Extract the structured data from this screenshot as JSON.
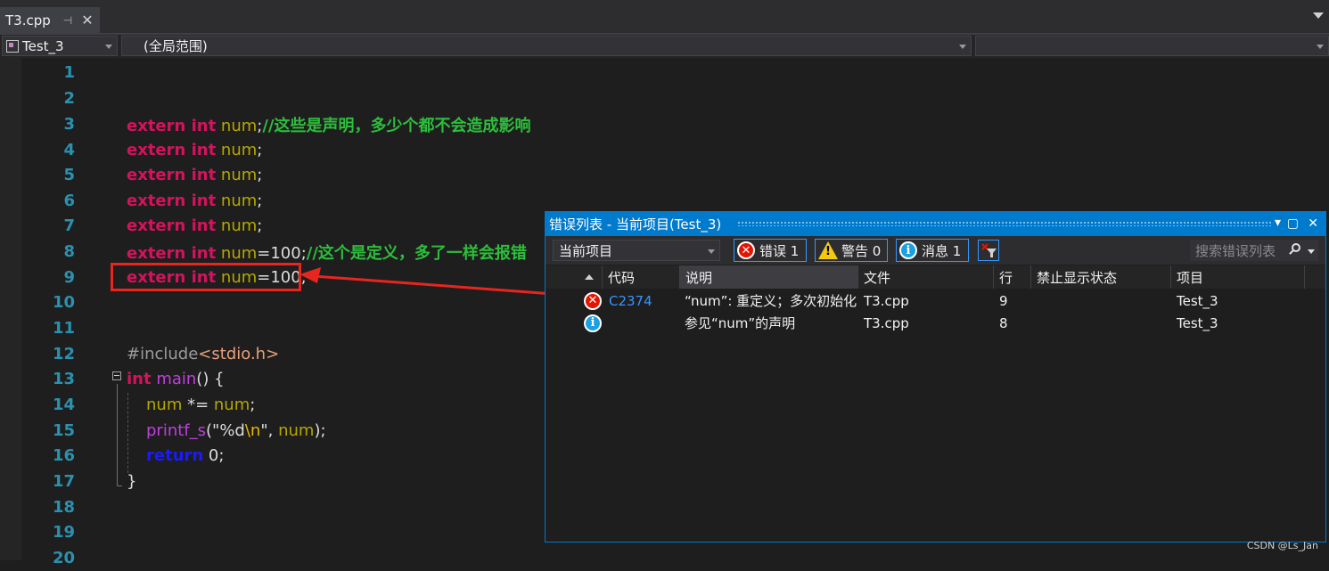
{
  "tab": {
    "filename": "T3.cpp",
    "pin": "⊣",
    "close": "✕"
  },
  "navbar": {
    "project": "Test_3",
    "scope": "(全局范围)",
    "members": ""
  },
  "editor": {
    "line_numbers": [
      "1",
      "2",
      "3",
      "4",
      "5",
      "6",
      "7",
      "8",
      "9",
      "10",
      "11",
      "12",
      "13",
      "14",
      "15",
      "16",
      "17",
      "18",
      "19",
      "20"
    ],
    "code": {
      "l3_kw": "extern int",
      "l3_var": " num",
      "l3_semi": ";",
      "l3_cmt": "//这些是声明，多少个都不会造成影响",
      "l4_kw": "extern int",
      "l4_var": " num",
      "l4_semi": ";",
      "l5_kw": "extern int",
      "l5_var": " num",
      "l5_semi": ";",
      "l6_kw": "extern int",
      "l6_var": " num",
      "l6_semi": ";",
      "l7_kw": "extern int",
      "l7_var": " num",
      "l7_semi": ";",
      "l8_kw": "extern int",
      "l8_var": " num",
      "l8_rest": "=100;",
      "l8_cmt": "//这个是定义，多了一样会报错",
      "l9_kw": "extern int",
      "l9_var": " num",
      "l9_rest": "=100;",
      "l12_pre": "#include",
      "l12_inc": "<stdio.h>",
      "l13_kw": "int",
      "l13_fn": " main",
      "l13_rest": "() {",
      "l14_var": "num",
      "l14_op": " *= ",
      "l14_var2": "num",
      "l14_semi": ";",
      "l15_fn": "printf_s",
      "l15_p1": "(",
      "l15_str1": "\"%d",
      "l15_esc": "\\n",
      "l15_str2": "\"",
      "l15_p2": ", ",
      "l15_var": "num",
      "l15_p3": ");",
      "l16_kw": "return",
      "l16_rest": " 0;",
      "l17": "}"
    }
  },
  "error_list": {
    "title": "错误列表 - 当前项目(Test_3)",
    "scope_select": "当前项目",
    "errors_btn": "错误 1",
    "warnings_btn": "警告 0",
    "messages_btn": "消息 1",
    "search_placeholder": "搜索错误列表",
    "columns": [
      "代码",
      "说明",
      "文件",
      "行",
      "禁止显示状态",
      "项目"
    ],
    "rows": [
      {
        "type": "error",
        "code": "C2374",
        "desc": "“num”: 重定义；多次初始化",
        "file": "T3.cpp",
        "line": "9",
        "suppress": "",
        "project": "Test_3"
      },
      {
        "type": "info",
        "code": "",
        "desc": "参见“num”的声明",
        "file": "T3.cpp",
        "line": "8",
        "suppress": "",
        "project": "Test_3"
      }
    ]
  },
  "watermark": "CSDN @Ls_Jan",
  "colors": {
    "accent": "#007acc",
    "highlight": "#e8251e",
    "keyword": "#d3145c",
    "comment": "#2dbe3c"
  }
}
